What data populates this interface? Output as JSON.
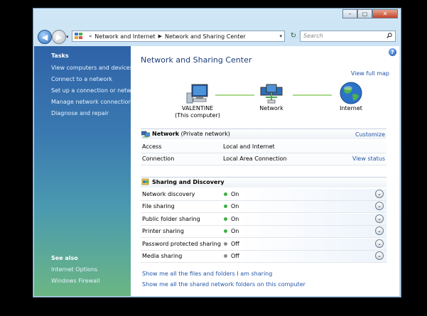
{
  "window": {
    "controls": {
      "minimize": "–",
      "maximize": "▢",
      "close": "✕"
    }
  },
  "toolbar": {
    "back": "◀",
    "forward": "▶",
    "history_dropdown": "▾",
    "breadcrumb_prefix": "«",
    "breadcrumbs": [
      "Network and Internet",
      "Network and Sharing Center"
    ],
    "address_dropdown": "▾",
    "refresh": "↻",
    "search_placeholder": "Search"
  },
  "sidebar": {
    "tasks_heading": "Tasks",
    "tasks": [
      "View computers and devices",
      "Connect to a network",
      "Set up a connection or network",
      "Manage network connections",
      "Diagnose and repair"
    ],
    "see_also_heading": "See also",
    "see_also": [
      "Internet Options",
      "Windows Firewall"
    ]
  },
  "main": {
    "help": "?",
    "title": "Network and Sharing Center",
    "view_full_map": "View full map",
    "map_nodes": {
      "computer": {
        "name": "VALENTINE",
        "sub": "(This computer)"
      },
      "network": {
        "name": "Network"
      },
      "internet": {
        "name": "Internet"
      }
    },
    "network": {
      "name": "Network",
      "type": "(Private network)",
      "customize": "Customize",
      "rows": [
        {
          "label": "Access",
          "value": "Local and Internet",
          "action": ""
        },
        {
          "label": "Connection",
          "value": "Local Area Connection",
          "action": "View status"
        }
      ]
    },
    "sharing": {
      "title": "Sharing and Discovery",
      "chevron": "⌄",
      "rows": [
        {
          "label": "Network discovery",
          "state": "On",
          "color": "#3cb043"
        },
        {
          "label": "File sharing",
          "state": "On",
          "color": "#3cb043"
        },
        {
          "label": "Public folder sharing",
          "state": "On",
          "color": "#3cb043"
        },
        {
          "label": "Printer sharing",
          "state": "On",
          "color": "#3cb043"
        },
        {
          "label": "Password protected sharing",
          "state": "Off",
          "color": "#8a8a8a"
        },
        {
          "label": "Media sharing",
          "state": "Off",
          "color": "#8a8a8a"
        }
      ]
    },
    "links": [
      "Show me all the files and folders I am sharing",
      "Show me all the shared network folders on this computer"
    ]
  }
}
